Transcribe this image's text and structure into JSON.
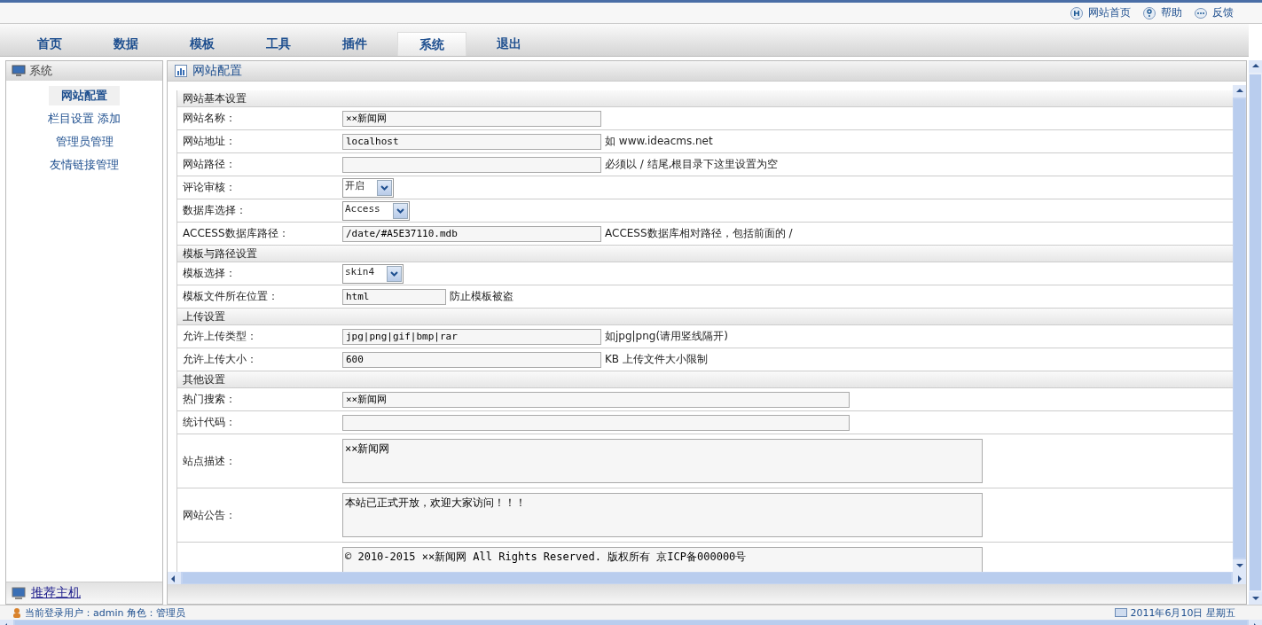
{
  "top_links": [
    {
      "kind": "home",
      "label": "网站首页"
    },
    {
      "kind": "help",
      "label": "帮助"
    },
    {
      "kind": "feedback",
      "label": "反馈"
    }
  ],
  "tabs": [
    {
      "label": "首页",
      "selected": false
    },
    {
      "label": "数据",
      "selected": false
    },
    {
      "label": "模板",
      "selected": false
    },
    {
      "label": "工具",
      "selected": false
    },
    {
      "label": "插件",
      "selected": false
    },
    {
      "label": "系统",
      "selected": true
    },
    {
      "label": "退出",
      "selected": false
    }
  ],
  "sidebar": {
    "title": "系统",
    "items": [
      {
        "label": "网站配置",
        "selected": true
      },
      {
        "label": "栏目设置",
        "extra": "添加",
        "selected": false
      },
      {
        "label": "管理员管理",
        "selected": false
      },
      {
        "label": "友情链接管理",
        "selected": false
      }
    ],
    "footer_link": "推荐主机"
  },
  "panel": {
    "title": "网站配置",
    "sections": [
      {
        "title": "网站基本设置",
        "fields": [
          {
            "label": "网站名称：",
            "kind": "input",
            "value": "××新闻网"
          },
          {
            "label": "网站地址：",
            "kind": "input",
            "value": "localhost",
            "hint": "如 www.ideacms.net"
          },
          {
            "label": "网站路径：",
            "kind": "input",
            "hint": "必须以 / 结尾,根目录下这里设置为空"
          },
          {
            "label": "评论审核：",
            "kind": "select",
            "value": "开启"
          },
          {
            "label": "数据库选择：",
            "kind": "select",
            "value": "Access"
          },
          {
            "label": "ACCESS数据库路径：",
            "kind": "input",
            "value": "/date/#A5E37110.mdb",
            "hint": "ACCESS数据库相对路径，包括前面的 /"
          }
        ]
      },
      {
        "title": "模板与路径设置",
        "fields": [
          {
            "label": "模板选择：",
            "kind": "select",
            "value": "skin4"
          },
          {
            "label": "模板文件所在位置：",
            "kind": "short",
            "value": "html",
            "hint": "防止模板被盗"
          }
        ]
      },
      {
        "title": "上传设置",
        "fields": [
          {
            "label": "允许上传类型：",
            "kind": "input",
            "value": "jpg|png|gif|bmp|rar",
            "hint": "如jpg|png(请用竖线隔开)"
          },
          {
            "label": "允许上传大小：",
            "kind": "input",
            "value": "600",
            "hint": "KB 上传文件大小限制"
          }
        ]
      },
      {
        "title": "其他设置",
        "fields": [
          {
            "label": "热门搜索：",
            "kind": "wide",
            "value": "××新闻网"
          },
          {
            "label": "统计代码：",
            "kind": "wide"
          },
          {
            "label": "站点描述：",
            "kind": "textarea",
            "value": "××新闻网"
          },
          {
            "label": "网站公告：",
            "kind": "textarea",
            "value": "本站已正式开放，欢迎大家访问！！！"
          },
          {
            "kind": "textarea",
            "value": "© 2010-2015 ××新闻网 All Rights Reserved. 版权所有 京ICP备000000号"
          }
        ]
      }
    ]
  },
  "status_bar": {
    "user": "当前登录用户：admin 角色：管理员",
    "date": "2011年6月10日 星期五"
  }
}
